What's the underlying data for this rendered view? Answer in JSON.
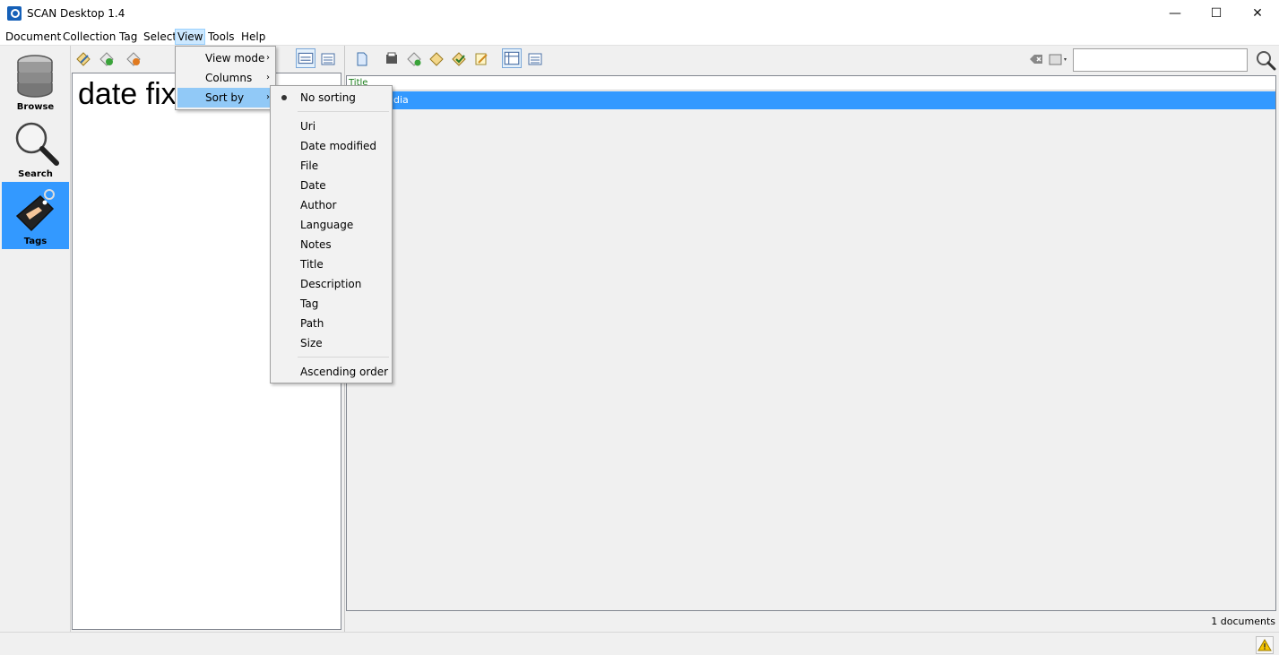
{
  "window": {
    "title": "SCAN Desktop 1.4",
    "minimize_glyph": "—",
    "maximize_glyph": "☐",
    "close_glyph": "✕"
  },
  "menubar": [
    "Document",
    "Collection",
    "Tag",
    "Select",
    "View",
    "Tools",
    "Help"
  ],
  "nav": {
    "items": [
      {
        "label": "Browse",
        "icon": "database-icon"
      },
      {
        "label": "Search",
        "icon": "magnifier-icon"
      },
      {
        "label": "Tags",
        "icon": "tag-icon"
      }
    ],
    "selected": "Tags"
  },
  "tags_pane": {
    "tag_word": "date fix"
  },
  "documents": {
    "header": "Title",
    "row_text": "dia",
    "count": "1 documents"
  },
  "search": {
    "placeholder": ""
  },
  "view_menu": {
    "items": [
      {
        "label": "View mode",
        "has_submenu": true
      },
      {
        "label": "Columns",
        "has_submenu": true
      },
      {
        "label": "Sort by",
        "has_submenu": true
      }
    ]
  },
  "sort_menu": {
    "checked": "No sorting",
    "group1": [
      "No sorting"
    ],
    "group2": [
      "Uri",
      "Date modified",
      "File",
      "Date",
      "Author",
      "Language",
      "Notes",
      "Title",
      "Description",
      "Tag",
      "Path",
      "Size"
    ],
    "group3": [
      "Ascending order"
    ]
  },
  "colors": {
    "selection": "#3399ff",
    "menu_highlight": "#91c9f7",
    "menubar_active": "#cce8ff"
  }
}
